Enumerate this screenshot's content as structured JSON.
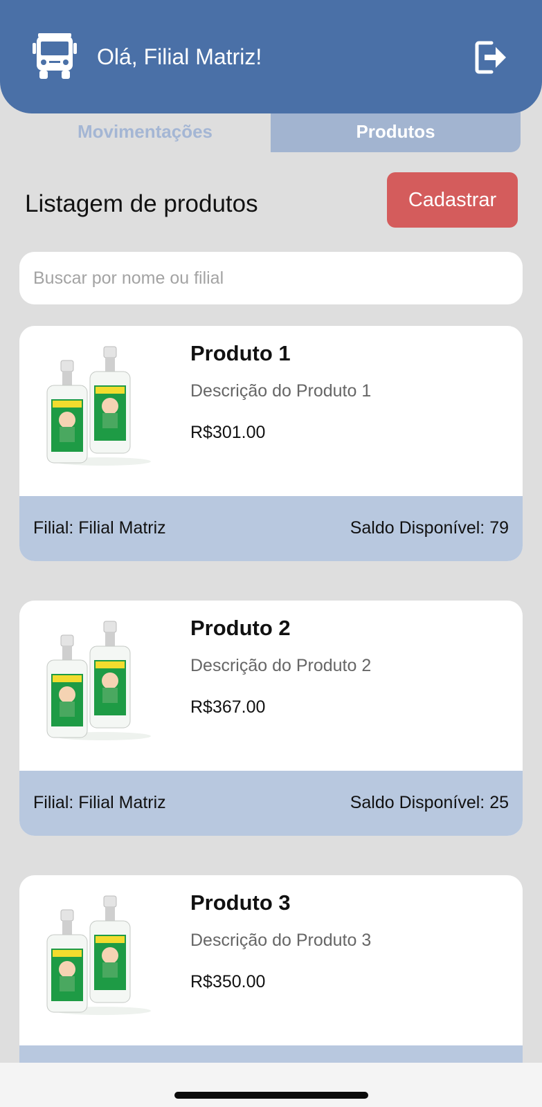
{
  "header": {
    "greeting": "Olá, Filial Matriz!",
    "bg_color": "#4a70a7",
    "truck_icon": "truck-icon",
    "logout_icon": "logout-icon"
  },
  "tabs": [
    {
      "label": "Movimentações",
      "active": false
    },
    {
      "label": "Produtos",
      "active": true
    }
  ],
  "section": {
    "title": "Listagem de produtos",
    "register_label": "Cadastrar",
    "register_color": "#d45c5c"
  },
  "search": {
    "placeholder": "Buscar por nome ou filial",
    "value": ""
  },
  "products": [
    {
      "name": "Produto 1",
      "description": "Descrição do Produto 1",
      "price": "R$301.00",
      "branch": "Filial: Filial Matriz",
      "stock": "Saldo Disponível: 79"
    },
    {
      "name": "Produto 2",
      "description": "Descrição do Produto 2",
      "price": "R$367.00",
      "branch": "Filial: Filial Matriz",
      "stock": "Saldo Disponível: 25"
    },
    {
      "name": "Produto 3",
      "description": "Descrição do Produto 3",
      "price": "R$350.00",
      "branch": "",
      "stock": ""
    }
  ]
}
